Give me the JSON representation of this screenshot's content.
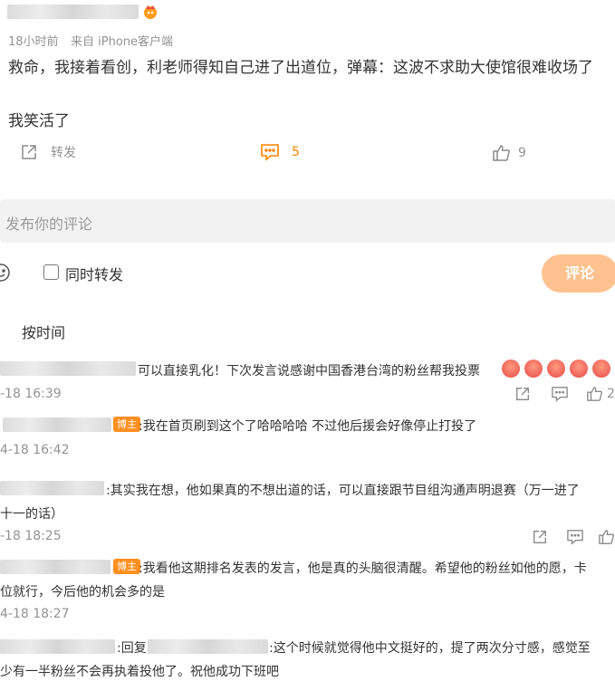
{
  "post": {
    "time": "18小时前",
    "source": "来自 iPhone客户端",
    "text_line1": "救命，我接着看创，利老师得知自己进了出道位，弹幕：这波不求助大使馆很难收场了",
    "text_line2": "我笑活了",
    "actions": {
      "forward": "转发",
      "comment_count": "5",
      "like_count": "9"
    }
  },
  "composer": {
    "placeholder": "发布你的评论",
    "also_forward": "同时转发",
    "submit": "评论"
  },
  "sort": {
    "label": "按时间"
  },
  "comments": [
    {
      "text": "可以直接乳化！下次发言说感谢中国香港台湾的粉丝帮我投票",
      "time": "-18 16:39",
      "partial_count": "2"
    },
    {
      "badge": "博主",
      "text": ":我在首页刷到这个了哈哈哈哈 不过他后援会好像停止打投了",
      "time": "4-18 16:42"
    },
    {
      "text": ":其实我在想，他如果真的不想出道的话，可以直接跟节目组沟通声明退赛（万一进了",
      "text2": "前十一的话）",
      "time": "-18 18:25"
    },
    {
      "badge": "博主",
      "text": ":我看他这期排名发表的发言，他是真的头脑很清醒。希望他的粉丝如他的愿，卡",
      "text2": "位就行，今后他的机会多的是",
      "time": "4-18 18:27"
    },
    {
      "reply_prefix": ":回复",
      "text": ":这个时候就觉得他中文挺好的，提了两次分寸感，感觉至",
      "text2": "少有一半粉丝不会再执着投他了。祝他成功下班吧"
    }
  ],
  "colors": {
    "accent": "#ff8200",
    "submit_bg": "#fdc28f",
    "muted": "#939393"
  }
}
